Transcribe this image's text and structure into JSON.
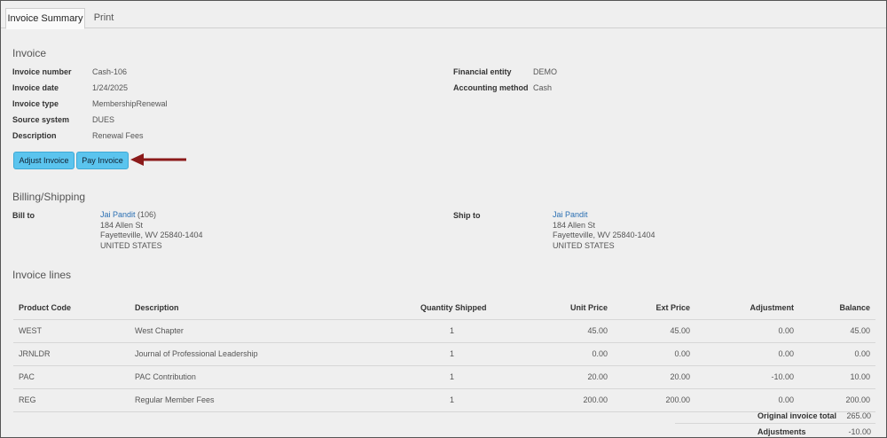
{
  "tabs": [
    {
      "label": "Invoice Summary"
    },
    {
      "label": "Print"
    }
  ],
  "invoice": {
    "title": "Invoice",
    "fields": [
      {
        "label": "Invoice number",
        "value": "Cash-106"
      },
      {
        "label": "Invoice date",
        "value": "1/24/2025"
      },
      {
        "label": "Invoice type",
        "value": "MembershipRenewal"
      },
      {
        "label": "Source system",
        "value": "DUES"
      },
      {
        "label": "Description",
        "value": "Renewal Fees"
      }
    ],
    "right_fields": [
      {
        "label": "Financial entity",
        "value": "DEMO"
      },
      {
        "label": "Accounting method",
        "value": "Cash"
      }
    ],
    "buttons": {
      "adjust": "Adjust Invoice",
      "pay": "Pay Invoice"
    }
  },
  "billing": {
    "title": "Billing/Shipping",
    "bill_to": {
      "label": "Bill to",
      "name": "Jai Pandit",
      "id": "(106)",
      "line1": "184 Allen St",
      "line2": "Fayetteville, WV 25840-1404",
      "line3": "UNITED STATES"
    },
    "ship_to": {
      "label": "Ship to",
      "name": "Jai Pandit",
      "line1": "184 Allen St",
      "line2": "Fayetteville, WV 25840-1404",
      "line3": "UNITED STATES"
    }
  },
  "lines": {
    "title": "Invoice lines",
    "headers": [
      "Product Code",
      "Description",
      "Quantity Shipped",
      "Unit Price",
      "Ext Price",
      "Adjustment",
      "Balance"
    ],
    "rows": [
      [
        "WEST",
        "West Chapter",
        "1",
        "45.00",
        "45.00",
        "0.00",
        "45.00"
      ],
      [
        "JRNLDR",
        "Journal of Professional Leadership",
        "1",
        "0.00",
        "0.00",
        "0.00",
        "0.00"
      ],
      [
        "PAC",
        "PAC Contribution",
        "1",
        "20.00",
        "20.00",
        "-10.00",
        "10.00"
      ],
      [
        "REG",
        "Regular Member Fees",
        "1",
        "200.00",
        "200.00",
        "0.00",
        "200.00"
      ]
    ],
    "totals": [
      {
        "label": "Original invoice total",
        "value": "265.00"
      },
      {
        "label": "Adjustments",
        "value": "-10.00"
      }
    ]
  },
  "colors": {
    "button": "#5bc4ee",
    "arrow": "#8b1a1a",
    "link": "#2a6fb3"
  }
}
